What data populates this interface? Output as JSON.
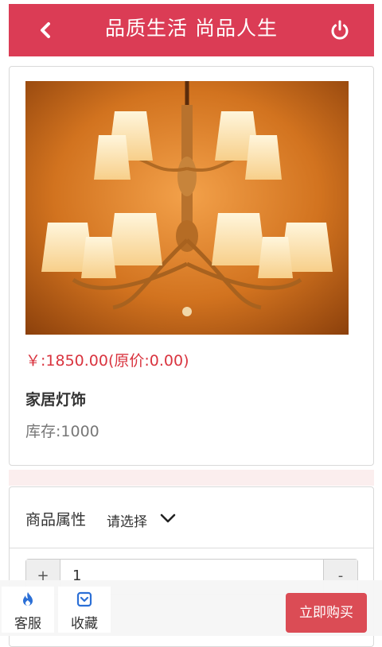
{
  "header": {
    "title": "品质生活  尚品人生",
    "back_icon": "chevron-left-icon",
    "power_icon": "power-icon",
    "color": "#db3c55"
  },
  "product": {
    "image": "chandelier-photo",
    "price": "￥:1850.00(原价:0.00)",
    "name": "家居灯饰",
    "stock": "库存:1000"
  },
  "attributes": {
    "label": "商品属性",
    "select_text": "请选择",
    "chevron_icon": "chevron-down-icon"
  },
  "quantity": {
    "plus": "+",
    "value": "1",
    "minus": "-"
  },
  "bottom_bar": {
    "service_label": "客服",
    "service_icon": "flame-icon",
    "favorite_label": "收藏",
    "favorite_icon": "bookmark-icon",
    "buy_label": "立即购买",
    "buy_color": "#db4c55"
  }
}
